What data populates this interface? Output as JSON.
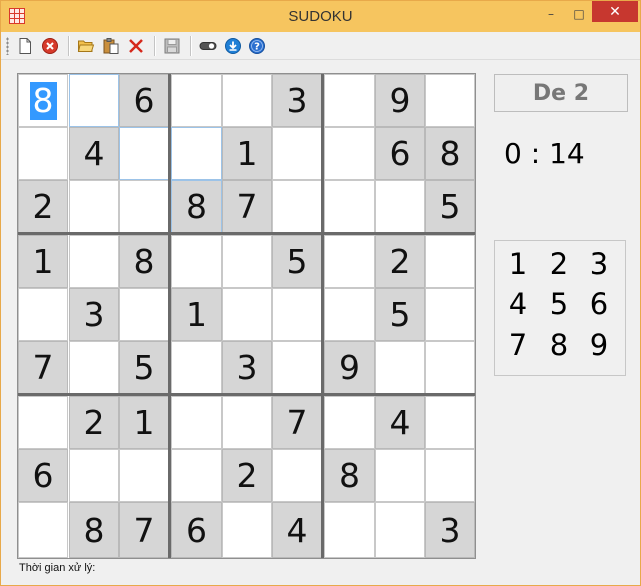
{
  "window": {
    "title": "SUDOKU",
    "minimize_glyph": "–",
    "maximize_glyph": "□",
    "close_glyph": "✕",
    "icon": "sudoku-grid-icon"
  },
  "toolbar": {
    "items": [
      {
        "name": "new-icon"
      },
      {
        "name": "delete-icon"
      },
      {
        "name": "open-folder-icon"
      },
      {
        "name": "paste-icon"
      },
      {
        "name": "cut-icon"
      },
      {
        "name": "save-icon"
      },
      {
        "name": "toggle-icon"
      },
      {
        "name": "download-icon"
      },
      {
        "name": "help-icon"
      }
    ]
  },
  "board": {
    "rows": [
      [
        "8",
        "",
        "6",
        "",
        "",
        "3",
        "",
        "9",
        ""
      ],
      [
        "",
        "4",
        "",
        "",
        "1",
        "",
        "",
        "6",
        "8"
      ],
      [
        "2",
        "",
        "",
        "8",
        "7",
        "",
        "",
        "",
        "5"
      ],
      [
        "1",
        "",
        "8",
        "",
        "",
        "5",
        "",
        "2",
        ""
      ],
      [
        "",
        "3",
        "",
        "1",
        "",
        "",
        "",
        "5",
        ""
      ],
      [
        "7",
        "",
        "5",
        "",
        "3",
        "",
        "9",
        "",
        ""
      ],
      [
        "",
        "2",
        "1",
        "",
        "",
        "7",
        "",
        "4",
        ""
      ],
      [
        "6",
        "",
        "",
        "",
        "2",
        "",
        "8",
        "",
        ""
      ],
      [
        "",
        "8",
        "7",
        "6",
        "",
        "4",
        "",
        "",
        "3"
      ]
    ],
    "given": [
      [
        0,
        0,
        1,
        0,
        0,
        1,
        0,
        1,
        0
      ],
      [
        0,
        1,
        0,
        0,
        1,
        0,
        0,
        1,
        1
      ],
      [
        1,
        0,
        0,
        1,
        1,
        0,
        0,
        0,
        1
      ],
      [
        1,
        0,
        1,
        0,
        0,
        1,
        0,
        1,
        0
      ],
      [
        0,
        1,
        0,
        1,
        0,
        0,
        0,
        1,
        0
      ],
      [
        1,
        0,
        1,
        0,
        1,
        0,
        1,
        0,
        0
      ],
      [
        0,
        1,
        1,
        0,
        0,
        1,
        0,
        1,
        0
      ],
      [
        1,
        0,
        0,
        0,
        1,
        0,
        1,
        0,
        0
      ],
      [
        0,
        1,
        1,
        1,
        0,
        1,
        0,
        0,
        1
      ]
    ],
    "selected": [
      0,
      0
    ],
    "highlighted": [
      [
        0,
        1
      ],
      [
        1,
        2
      ],
      [
        1,
        3
      ],
      [
        2,
        3
      ]
    ]
  },
  "level_label": "De 2",
  "timer": {
    "minutes": "0",
    "separator": ":",
    "seconds": "14"
  },
  "numpad": [
    "1",
    "2",
    "3",
    "4",
    "5",
    "6",
    "7",
    "8",
    "9"
  ],
  "status_label": "Thời gian xử lý:",
  "colors": {
    "titlebar": "#f6c55f",
    "close": "#c7372f",
    "given_cell": "#d6d6d6",
    "selection": "#3399ff"
  }
}
